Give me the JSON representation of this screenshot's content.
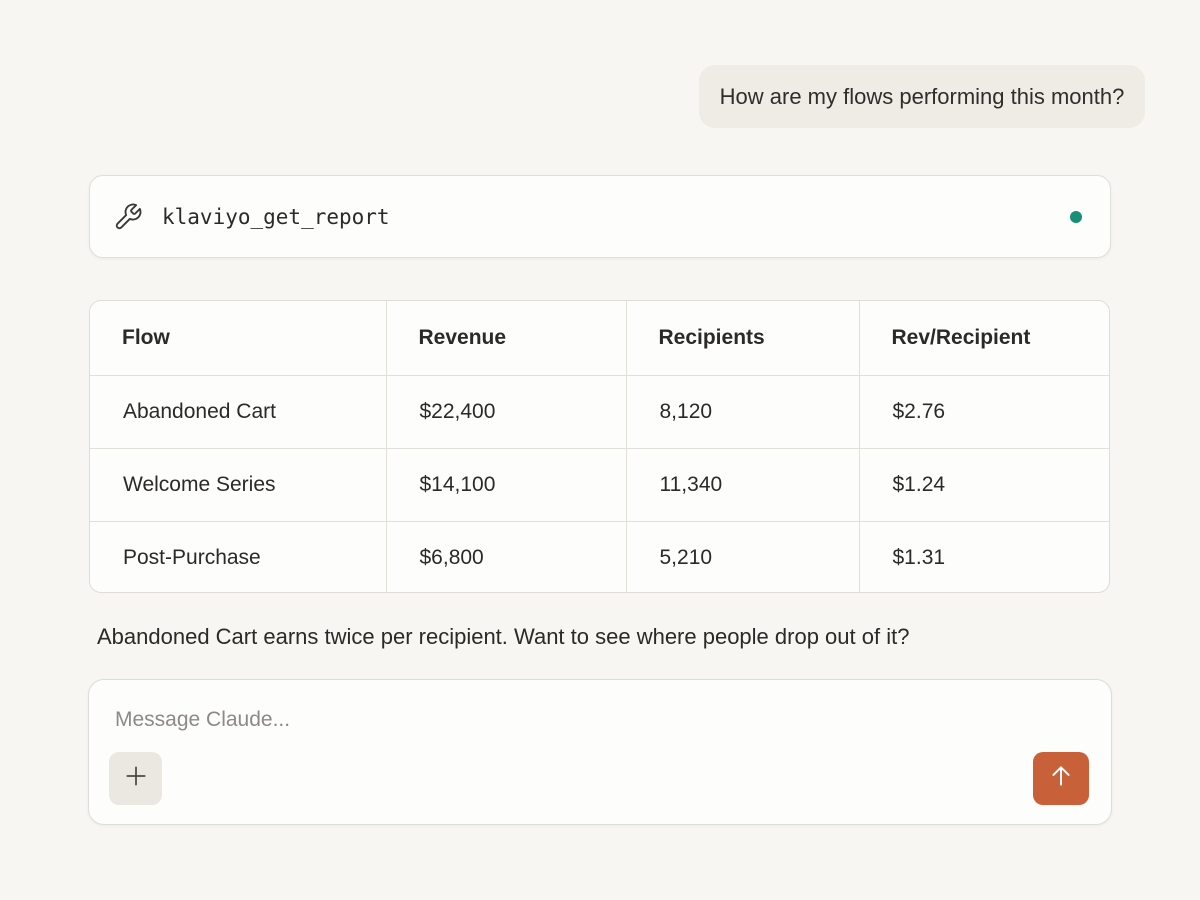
{
  "conversation": {
    "user_message": "How are my flows performing this month?",
    "tool_call": {
      "icon": "wrench-icon",
      "name": "klaviyo_get_report",
      "status_color": "#1a8f78"
    },
    "report_table": {
      "columns": [
        "Flow",
        "Revenue",
        "Recipients",
        "Rev/Recipient"
      ],
      "rows": [
        [
          "Abandoned Cart",
          "$22,400",
          "8,120",
          "$2.76"
        ],
        [
          "Welcome Series",
          "$14,100",
          "11,340",
          "$1.24"
        ],
        [
          "Post-Purchase",
          "$6,800",
          "5,210",
          "$1.31"
        ]
      ]
    },
    "assistant_message": "Abandoned Cart earns twice per recipient. Want to see where people drop out of it?"
  },
  "composer": {
    "placeholder": "Message Claude...",
    "add_icon": "plus-icon",
    "send_icon": "arrow-up-icon",
    "send_color": "#c8603a"
  }
}
